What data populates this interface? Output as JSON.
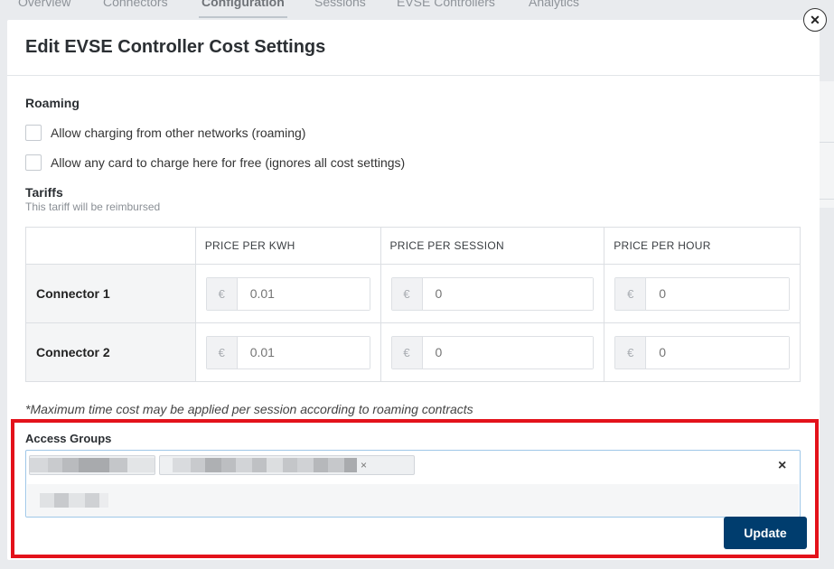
{
  "background": {
    "tabs": [
      "Overview",
      "Connectors",
      "Configuration",
      "Sessions",
      "EVSE Controllers",
      "Analytics"
    ],
    "active_tab": "Configuration"
  },
  "modal": {
    "title": "Edit EVSE Controller Cost Settings",
    "close_symbol": "✕"
  },
  "roaming": {
    "title": "Roaming",
    "options": [
      {
        "label": "Allow charging from other networks (roaming)",
        "checked": false
      },
      {
        "label": "Allow any card to charge here for free (ignores all cost settings)",
        "checked": false
      }
    ]
  },
  "tariffs": {
    "title": "Tariffs",
    "subtitle": "This tariff will be reimbursed",
    "columns": [
      "PRICE PER KWH",
      "PRICE PER SESSION",
      "PRICE PER HOUR"
    ],
    "currency_symbol": "€",
    "rows": [
      {
        "label": "Connector 1",
        "values": [
          "0.01",
          "0",
          "0"
        ]
      },
      {
        "label": "Connector 2",
        "values": [
          "0.01",
          "0",
          "0"
        ]
      }
    ],
    "note": "*Maximum time cost may be applied per session according to roaming contracts"
  },
  "access_groups": {
    "label": "Access Groups",
    "chip_remove_symbol": "×",
    "clear_symbol": "×"
  },
  "footer": {
    "update_label": "Update"
  },
  "colors": {
    "primary_button": "#003d6e",
    "highlight": "#e3121b",
    "focus_border": "#9fc7e8"
  }
}
